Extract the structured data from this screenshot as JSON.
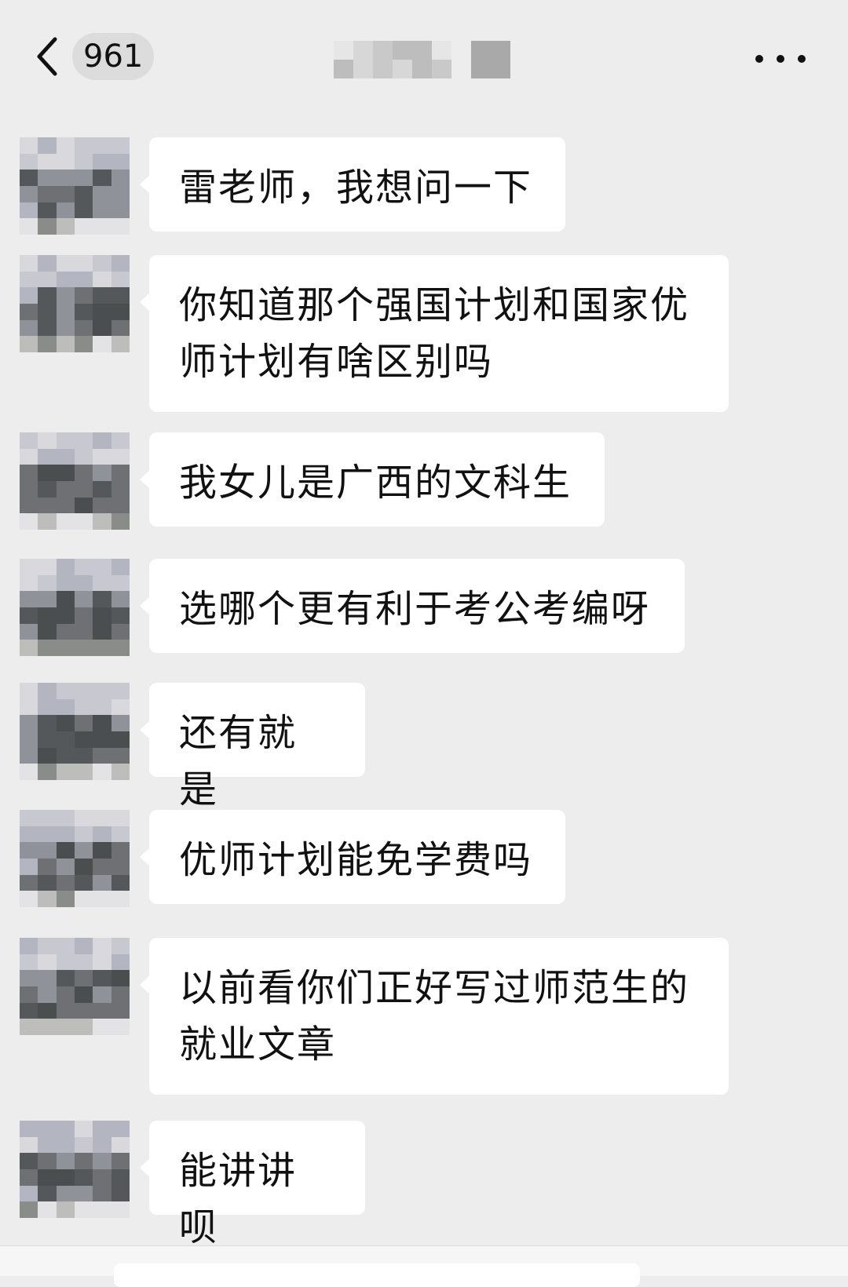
{
  "header": {
    "unread_count": "961",
    "back_icon": "chevron-left-icon",
    "more_icon": "more-dots-icon"
  },
  "messages": [
    {
      "text": "雷老师，我想问一下"
    },
    {
      "text": "你知道那个强国计划和国家优师计划有啥区别吗"
    },
    {
      "text": "我女儿是广西的文科生"
    },
    {
      "text": "选哪个更有利于考公考编呀"
    },
    {
      "text": "还有就是"
    },
    {
      "text": "优师计划能免学费吗"
    },
    {
      "text": "以前看你们正好写过师范生的就业文章"
    },
    {
      "text": "能讲讲呗"
    }
  ],
  "colors": {
    "background": "#ededed",
    "bubble": "#ffffff",
    "text": "#111111",
    "badge": "#dcdcdc"
  }
}
